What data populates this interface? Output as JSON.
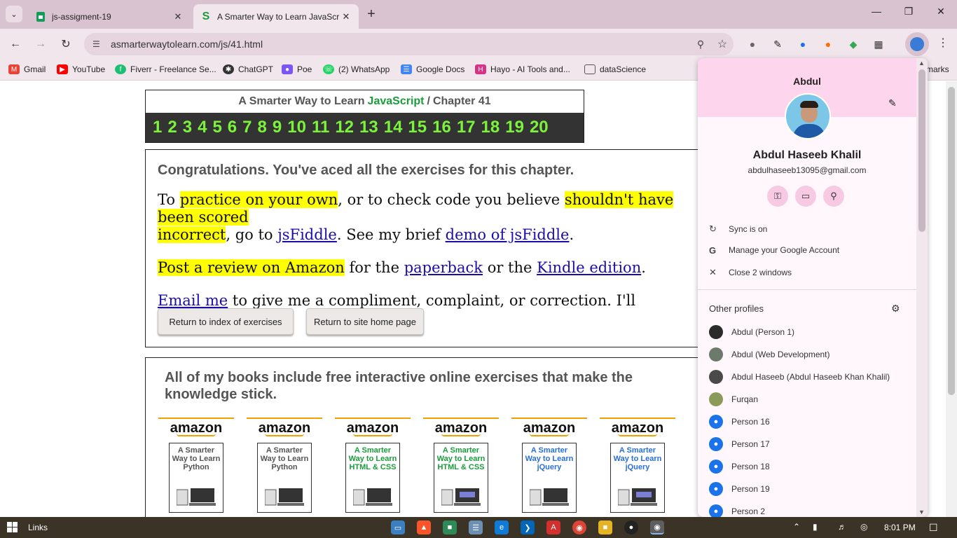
{
  "browser": {
    "tabs": [
      {
        "title": "js-assigment-19",
        "active": false
      },
      {
        "title": "A Smarter Way to Learn JavaScr",
        "active": true
      }
    ],
    "url": "asmarterwaytolearn.com/js/41.html",
    "bookmarks": [
      {
        "label": "Gmail",
        "icon": "gmail-icon",
        "color": "#ea4335"
      },
      {
        "label": "YouTube",
        "icon": "youtube-icon",
        "color": "#ff0000"
      },
      {
        "label": "Fiverr - Freelance Se...",
        "icon": "fiverr-icon",
        "color": "#1dbf73"
      },
      {
        "label": "ChatGPT",
        "icon": "chatgpt-icon",
        "color": "#333333"
      },
      {
        "label": "Poe",
        "icon": "poe-icon",
        "color": "#7d55f5"
      },
      {
        "label": "(2) WhatsApp",
        "icon": "whatsapp-icon",
        "color": "#25d366"
      },
      {
        "label": "Google Docs",
        "icon": "google-docs-icon",
        "color": "#4285f4"
      },
      {
        "label": "Hayo - AI Tools and...",
        "icon": "hayo-icon",
        "color": "#d63384"
      },
      {
        "label": "dataScience",
        "icon": "folder-icon",
        "color": "#555555"
      }
    ],
    "bookmarks_more": "marks"
  },
  "page": {
    "chapter_prefix": "A Smarter Way to Learn",
    "chapter_js": "JavaScript",
    "chapter_sep": "/",
    "chapter_label": "Chapter 41",
    "chapter_numbers": [
      "1",
      "2",
      "3",
      "4",
      "5",
      "6",
      "7",
      "8",
      "9",
      "10",
      "11",
      "12",
      "13",
      "14",
      "15",
      "16",
      "17",
      "18",
      "19",
      "20"
    ],
    "congrats_title": "Congratulations. You've aced all the exercises for this chapter.",
    "p1": {
      "t1": "To ",
      "hl1": "practice on your own",
      "t2": ", or to check code you believe ",
      "hl2": "shouldn't have been scored",
      "hl3": "incorrect",
      "t3": ", go to ",
      "link1": "jsFiddle",
      "t4": ". See my brief ",
      "link2": "demo of jsFiddle",
      "t5": "."
    },
    "p2": {
      "hl": "Post a review on Amazon",
      "t1": " for the ",
      "link1": "paperback",
      "t2": " or the ",
      "link2": "Kindle edition",
      "t3": "."
    },
    "p3": {
      "link": "Email me",
      "t": " to give me a compliment, complaint, or correction. I'll respond."
    },
    "btn_index": "Return to index of exercises",
    "btn_home": "Return to site home page",
    "books_title": "All of my books include free interactive online exercises that make the knowledge stick.",
    "books": [
      {
        "brand": "amazon",
        "title": "A Smarter Way to Learn Python",
        "style": "gray"
      },
      {
        "brand": "amazon",
        "title": "A Smarter Way to Learn Python",
        "style": "gray"
      },
      {
        "brand": "amazon",
        "title": "A Smarter Way to Learn HTML & CSS",
        "style": "green"
      },
      {
        "brand": "amazon",
        "title": "A Smarter Way to Learn HTML & CSS",
        "style": "green"
      },
      {
        "brand": "amazon",
        "title": "A Smarter Way to Learn jQuery",
        "style": "blue"
      },
      {
        "brand": "amazon",
        "title": "A Smarter Way to Learn jQuery",
        "style": "blue"
      }
    ]
  },
  "profile_panel": {
    "short_name": "Abdul",
    "full_name": "Abdul Haseeb Khalil",
    "email": "abdulhaseeb13095@gmail.com",
    "quick_icons": [
      "key-icon",
      "card-icon",
      "location-icon"
    ],
    "rows": [
      {
        "icon": "sync-icon",
        "label": "Sync is on"
      },
      {
        "icon": "google-icon",
        "label": "Manage your Google Account"
      },
      {
        "icon": "close-icon",
        "label": "Close 2 windows"
      }
    ],
    "other_profiles_label": "Other profiles",
    "profiles": [
      {
        "name": "Abdul (Person 1)",
        "color": "#2b2b2b"
      },
      {
        "name": "Abdul (Web Development)",
        "color": "#6b7a6b"
      },
      {
        "name": "Abdul Haseeb (Abdul Haseeb Khan Khalil)",
        "color": "#4a4a4a"
      },
      {
        "name": "Furqan",
        "color": "#8a9a5b"
      },
      {
        "name": "Person 16",
        "color": "#1a73e8"
      },
      {
        "name": "Person 17",
        "color": "#1a73e8"
      },
      {
        "name": "Person 18",
        "color": "#1a73e8"
      },
      {
        "name": "Person 19",
        "color": "#1a73e8"
      },
      {
        "name": "Person 2",
        "color": "#1a73e8"
      }
    ]
  },
  "taskbar": {
    "links_label": "Links",
    "time": "8:01 PM"
  }
}
